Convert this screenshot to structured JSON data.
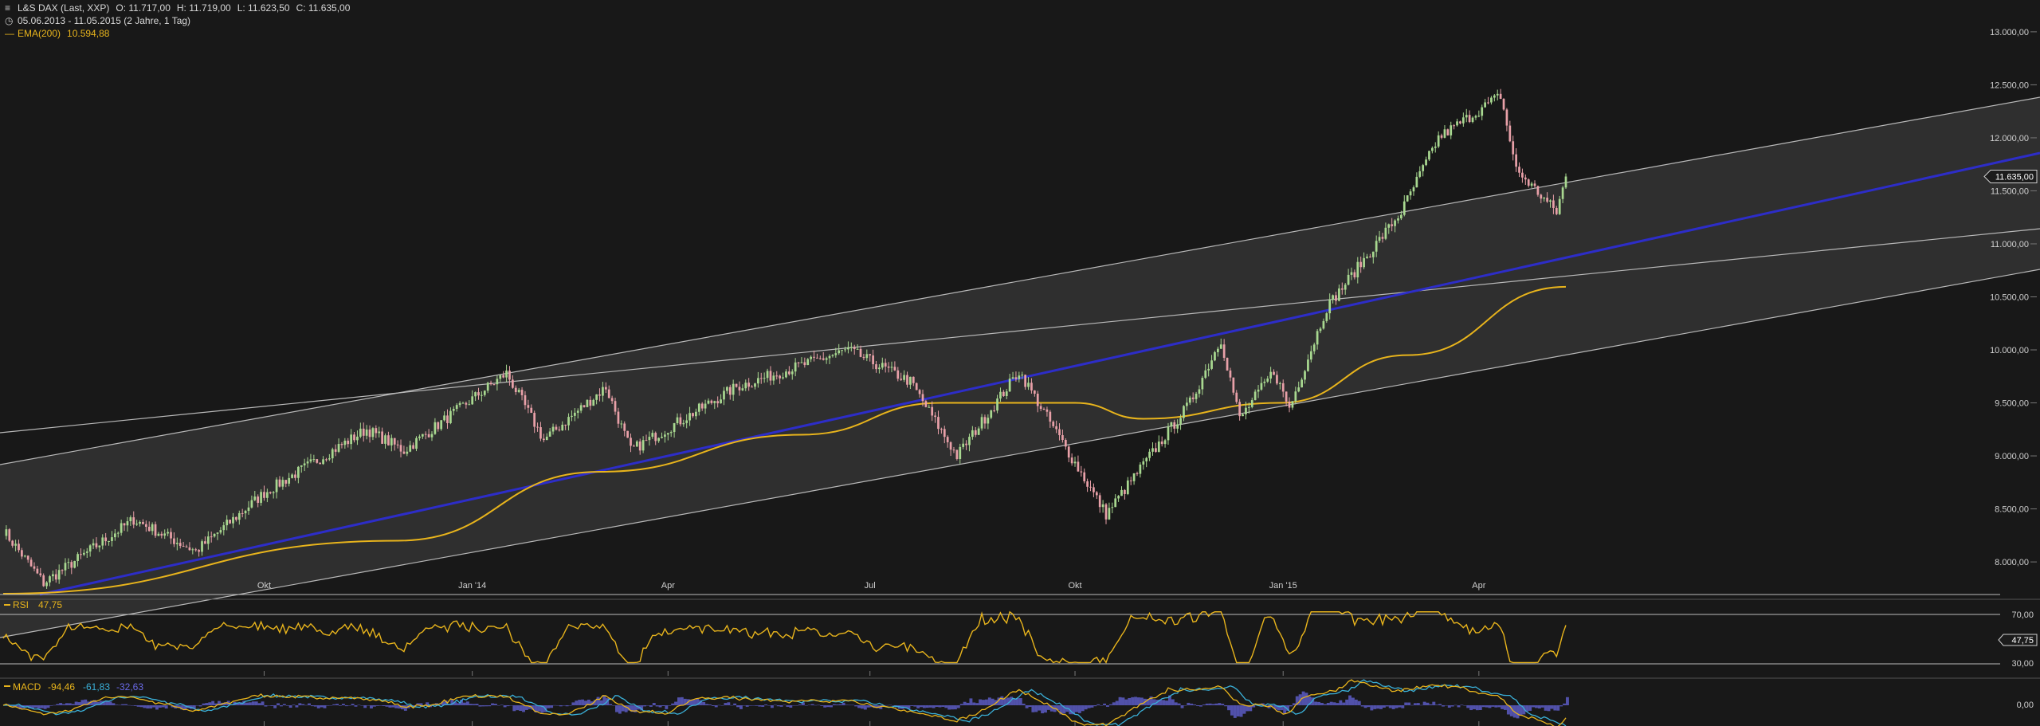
{
  "header": {
    "instrument": "L&S DAX (Last, XXP)",
    "open": "O: 11.717,00",
    "high": "H: 11.719,00",
    "low": "L: 11.623,50",
    "close": "C: 11.635,00",
    "period": "05.06.2013 - 11.05.2015 (2 Jahre, 1 Tag)",
    "ema_label": "EMA(200)",
    "ema_value": "10.594,88"
  },
  "colors": {
    "background": "#181818",
    "channel_fill": "#343434",
    "channel_line": "#b9b9b9",
    "trend_line": "#2d2dc8",
    "ema": "#e8b41c",
    "candle_up": "#a8d890",
    "candle_down": "#e8a0a8",
    "rsi": "#e8b41c",
    "rsi_over": "#b8e890",
    "rsi_under": "#f0a0a8",
    "macd": "#e8b41c",
    "macd_signal": "#3ab0d8",
    "macd_hist": "#6a6ae8"
  },
  "chart_data": [
    {
      "type": "candlestick",
      "title": "L&S DAX (Last, XXP)",
      "x_ticks": [
        "Okt",
        "Jan '14",
        "Apr",
        "Jul",
        "Okt",
        "Jan '15",
        "Apr"
      ],
      "y_ticks": [
        "8.000,00",
        "8.500,00",
        "9.000,00",
        "9.500,00",
        "10.000,00",
        "10.500,00",
        "11.000,00",
        "11.500,00",
        "12.000,00",
        "12.500,00",
        "13.000,00"
      ],
      "ylim": [
        7700,
        13300
      ],
      "last_price_label": "11.635,00",
      "key_points": [
        {
          "date": "2013-06-05",
          "close": 8300
        },
        {
          "date": "2013-06-24",
          "close": 7800
        },
        {
          "date": "2013-08-02",
          "close": 8400
        },
        {
          "date": "2013-08-30",
          "close": 8100
        },
        {
          "date": "2013-10-01",
          "close": 8650
        },
        {
          "date": "2013-11-15",
          "close": 9250
        },
        {
          "date": "2013-12-03",
          "close": 9050
        },
        {
          "date": "2014-01-17",
          "close": 9780
        },
        {
          "date": "2014-02-04",
          "close": 9150
        },
        {
          "date": "2014-03-04",
          "close": 9650
        },
        {
          "date": "2014-03-14",
          "close": 9050
        },
        {
          "date": "2014-05-01",
          "close": 9650
        },
        {
          "date": "2014-06-20",
          "close": 10000
        },
        {
          "date": "2014-07-18",
          "close": 9700
        },
        {
          "date": "2014-08-08",
          "close": 9000
        },
        {
          "date": "2014-09-05",
          "close": 9800
        },
        {
          "date": "2014-10-15",
          "close": 8450
        },
        {
          "date": "2014-11-21",
          "close": 9500
        },
        {
          "date": "2014-12-05",
          "close": 10100
        },
        {
          "date": "2014-12-15",
          "close": 9350
        },
        {
          "date": "2014-12-30",
          "close": 9800
        },
        {
          "date": "2015-01-06",
          "close": 9450
        },
        {
          "date": "2015-01-22",
          "close": 10400
        },
        {
          "date": "2015-02-25",
          "close": 11300
        },
        {
          "date": "2015-03-13",
          "close": 12000
        },
        {
          "date": "2015-04-10",
          "close": 12400
        },
        {
          "date": "2015-04-17",
          "close": 11700
        },
        {
          "date": "2015-05-06",
          "close": 11300
        },
        {
          "date": "2015-05-11",
          "close": 11635
        }
      ],
      "ema200_points": [
        {
          "date": "2013-06-05",
          "value": 7700
        },
        {
          "date": "2013-12-01",
          "value": 8200
        },
        {
          "date": "2014-03-01",
          "value": 8850
        },
        {
          "date": "2014-06-01",
          "value": 9200
        },
        {
          "date": "2014-08-01",
          "value": 9500
        },
        {
          "date": "2014-10-01",
          "value": 9500
        },
        {
          "date": "2014-11-01",
          "value": 9350
        },
        {
          "date": "2015-01-01",
          "value": 9500
        },
        {
          "date": "2015-03-01",
          "value": 9950
        },
        {
          "date": "2015-05-11",
          "value": 10595
        }
      ]
    },
    {
      "type": "line",
      "title": "RSI",
      "value_label": "47,75",
      "levels": [
        "70,00",
        "30,00"
      ],
      "ylim": [
        0,
        100
      ]
    },
    {
      "type": "line",
      "title": "MACD",
      "values": [
        "-94,46",
        "-61,83",
        "-32,63"
      ],
      "zero_label": "0,00"
    }
  ]
}
